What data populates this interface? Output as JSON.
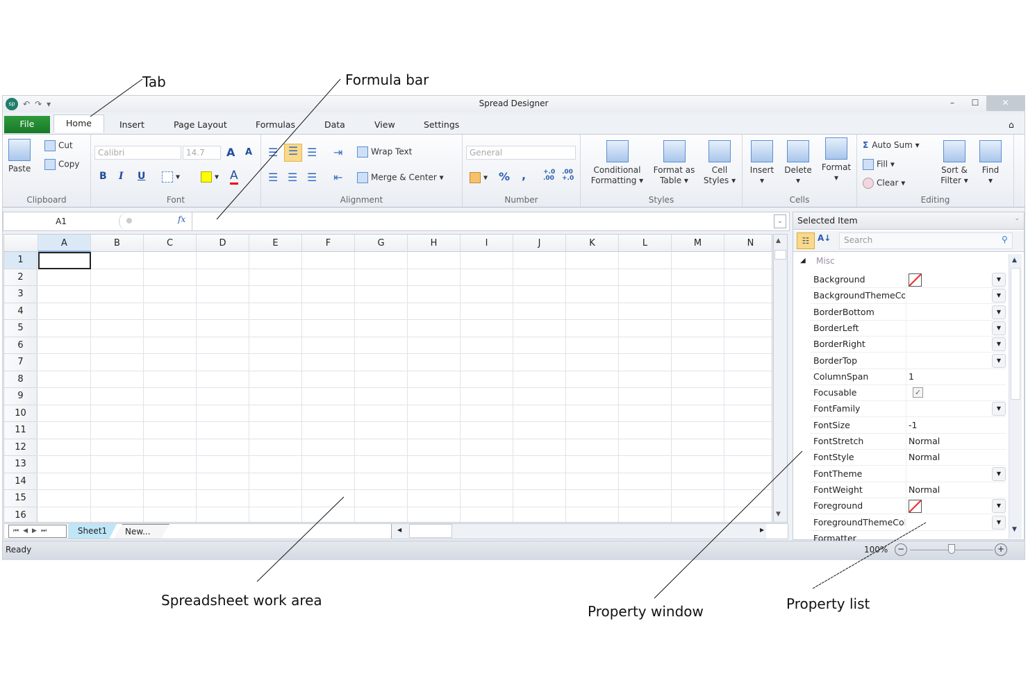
{
  "window": {
    "title": "Spread Designer",
    "minimize": "–",
    "maximize": "☐",
    "close": "✕",
    "help": "⌂",
    "logo": "sp"
  },
  "qat": {
    "undo": "↶",
    "redo": "↷",
    "customize": "▾"
  },
  "tabs": [
    {
      "label": "File"
    },
    {
      "label": "Home"
    },
    {
      "label": "Insert"
    },
    {
      "label": "Page Layout"
    },
    {
      "label": "Formulas"
    },
    {
      "label": "Data"
    },
    {
      "label": "View"
    },
    {
      "label": "Settings"
    }
  ],
  "ribbon": {
    "clipboard": {
      "label": "Clipboard",
      "paste": "Paste",
      "cut": "Cut",
      "copy": "Copy"
    },
    "font": {
      "label": "Font",
      "family": "Calibri",
      "size": "14.7",
      "bold": "B",
      "italic": "I",
      "underline": "U",
      "grow": "A",
      "shrink": "A",
      "fontcolor": "A"
    },
    "alignment": {
      "label": "Alignment",
      "wrap": "Wrap Text",
      "merge": "Merge & Center"
    },
    "number": {
      "label": "Number",
      "format": "General",
      "percent": "%",
      "comma": ",",
      "inc": "+.0 .00",
      "dec": ".00 +.0"
    },
    "styles": {
      "label": "Styles",
      "conditional": "Conditional Formatting",
      "table": "Format as Table",
      "cell": "Cell Styles"
    },
    "cells": {
      "label": "Cells",
      "insert": "Insert",
      "delete": "Delete",
      "format": "Format"
    },
    "editing": {
      "label": "Editing",
      "autosum": "Auto Sum",
      "fill": "Fill",
      "clear": "Clear",
      "sort": "Sort & Filter",
      "find": "Find"
    }
  },
  "formula_bar": {
    "name_box": "A1",
    "fx": "fx",
    "value": ""
  },
  "grid": {
    "columns": [
      "A",
      "B",
      "C",
      "D",
      "E",
      "F",
      "G",
      "H",
      "I",
      "J",
      "K",
      "L",
      "M",
      "N"
    ],
    "rows": [
      "1",
      "2",
      "3",
      "4",
      "5",
      "6",
      "7",
      "8",
      "9",
      "10",
      "11",
      "12",
      "13",
      "14",
      "15",
      "16"
    ],
    "selected_cell": "A1"
  },
  "sheets": {
    "tabs": [
      "Sheet1"
    ],
    "new_tab": "New...",
    "active": "Sheet1"
  },
  "status": {
    "text": "Ready",
    "zoom": "100%",
    "zoom_level": 0.5
  },
  "property_window": {
    "header": "Selected Item",
    "search_placeholder": "Search",
    "category": "Misc",
    "properties": [
      {
        "name": "Background",
        "value": "",
        "type": "color",
        "dropdown": true
      },
      {
        "name": "BackgroundThemeColor",
        "value": "",
        "dropdown": true
      },
      {
        "name": "BorderBottom",
        "value": "",
        "dropdown": true
      },
      {
        "name": "BorderLeft",
        "value": "",
        "dropdown": true
      },
      {
        "name": "BorderRight",
        "value": "",
        "dropdown": true
      },
      {
        "name": "BorderTop",
        "value": "",
        "dropdown": true
      },
      {
        "name": "ColumnSpan",
        "value": "1"
      },
      {
        "name": "Focusable",
        "value": "✓",
        "type": "check"
      },
      {
        "name": "FontFamily",
        "value": "",
        "dropdown": true
      },
      {
        "name": "FontSize",
        "value": "-1"
      },
      {
        "name": "FontStretch",
        "value": "Normal"
      },
      {
        "name": "FontStyle",
        "value": "Normal"
      },
      {
        "name": "FontTheme",
        "value": "",
        "dropdown": true
      },
      {
        "name": "FontWeight",
        "value": "Normal"
      },
      {
        "name": "Foreground",
        "value": "",
        "type": "color",
        "dropdown": true
      },
      {
        "name": "ForegroundThemeColor",
        "value": "",
        "dropdown": true
      },
      {
        "name": "Formatter",
        "value": ""
      }
    ]
  },
  "annotations": {
    "tab": "Tab",
    "formula_bar": "Formula bar",
    "work_area": "Spreadsheet work area",
    "property_window": "Property window",
    "property_list": "Property list"
  },
  "colors": {
    "file_tab": "#1f8a32",
    "accent": "#5c8fd0",
    "active_sheet": "#bfe6f7"
  }
}
